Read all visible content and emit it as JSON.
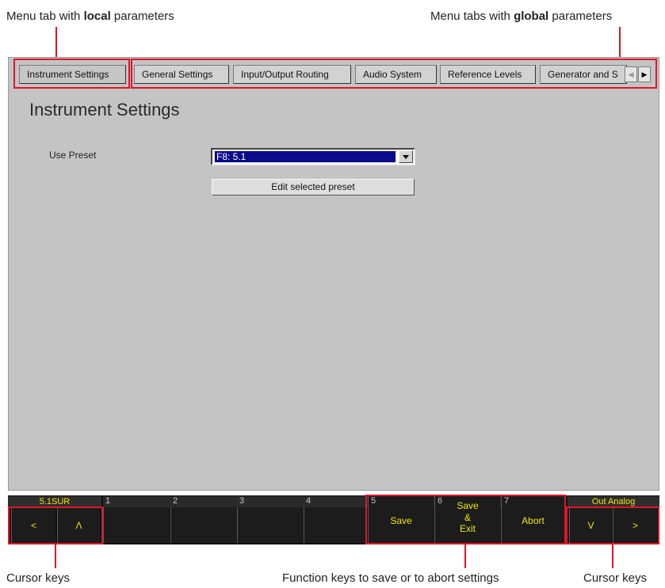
{
  "annotations": {
    "top_left": {
      "prefix": "Menu tab with ",
      "bold": "local",
      "suffix": " parameters"
    },
    "top_right": {
      "prefix": "Menu tabs  with ",
      "bold": "global",
      "suffix": " parameters"
    },
    "bottom_left": "Cursor keys",
    "bottom_center": "Function keys to save or to abort settings",
    "bottom_right": "Cursor keys",
    "accent_color": "#e0142a"
  },
  "tabs": {
    "local": "Instrument Settings",
    "global": [
      "General Settings",
      "Input/Output Routing",
      "Audio System",
      "Reference Levels",
      "Generator and S"
    ]
  },
  "page": {
    "title": "Instrument Settings",
    "use_preset_label": "Use Preset",
    "preset_value": "F8: 5.1",
    "edit_button": "Edit selected preset"
  },
  "keybar": {
    "left_status": "5.1SUR",
    "right_status": "Out Analog",
    "slot_numbers": [
      "1",
      "2",
      "3",
      "4",
      "5",
      "6",
      "7"
    ],
    "cursor_left": {
      "left": "<",
      "up": "Λ"
    },
    "cursor_right": {
      "down": "V",
      "right": ">"
    },
    "function_keys": [
      {
        "number": "5",
        "lines": [
          "Save"
        ]
      },
      {
        "number": "6",
        "lines": [
          "Save",
          "&",
          "Exit"
        ]
      },
      {
        "number": "7",
        "lines": [
          "Abort"
        ]
      }
    ],
    "label_color": "#f2e600"
  }
}
